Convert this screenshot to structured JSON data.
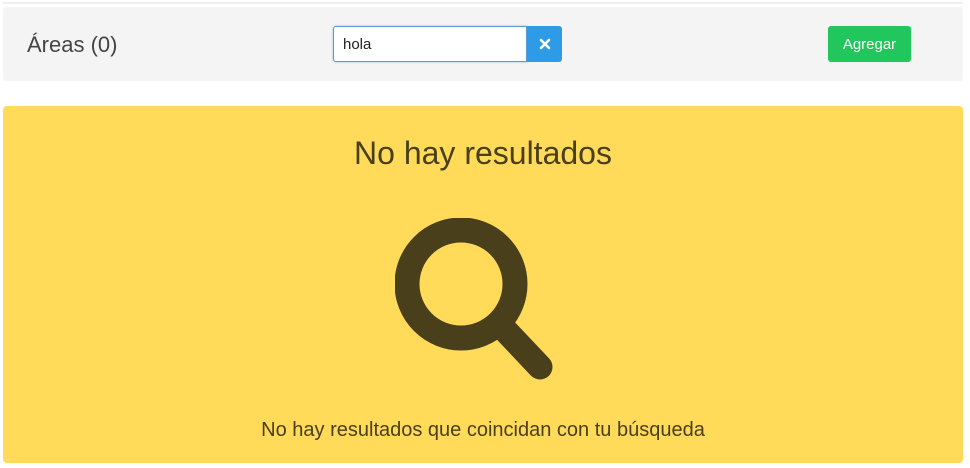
{
  "header": {
    "title": "Áreas (0)",
    "search": {
      "value": "hola",
      "placeholder": ""
    },
    "clear_icon": "close-icon",
    "add_label": "Agregar"
  },
  "empty_state": {
    "title": "No hay resultados",
    "icon": "search-icon",
    "message": "No hay resultados que coincidan con tu búsqueda"
  },
  "colors": {
    "header_background": "#f4f4f4",
    "clear_button": "#2e9be6",
    "add_button": "#21c65c",
    "empty_panel": "#ffdb59",
    "empty_text": "#4a3f1b"
  }
}
